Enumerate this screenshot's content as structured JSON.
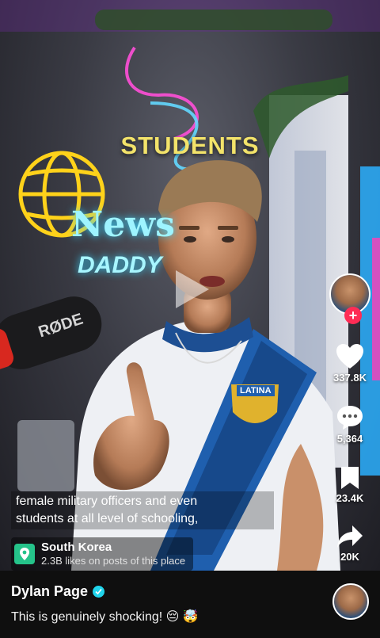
{
  "video": {
    "overlay_caption": "STUDENTS",
    "neon_sign_line1": "News",
    "neon_sign_line2": "DADDY",
    "mic_brand": "RØDE",
    "jersey_badge": "LATINA",
    "subtitle_lines": [
      "female military officers and even",
      "students at all level of schooling,"
    ]
  },
  "location": {
    "name": "South Korea",
    "stats": "2.3B likes on posts of this place",
    "icon": "location-pin-icon",
    "accent": "#25c38a"
  },
  "rail": {
    "like_count": "337.8K",
    "comment_count": "5,364",
    "bookmark_count": "23.4K",
    "share_count": "20K",
    "follow_color": "#fe2c55"
  },
  "post": {
    "author": "Dylan Page",
    "description": "This is genuinely shocking! 😔 🤯"
  }
}
